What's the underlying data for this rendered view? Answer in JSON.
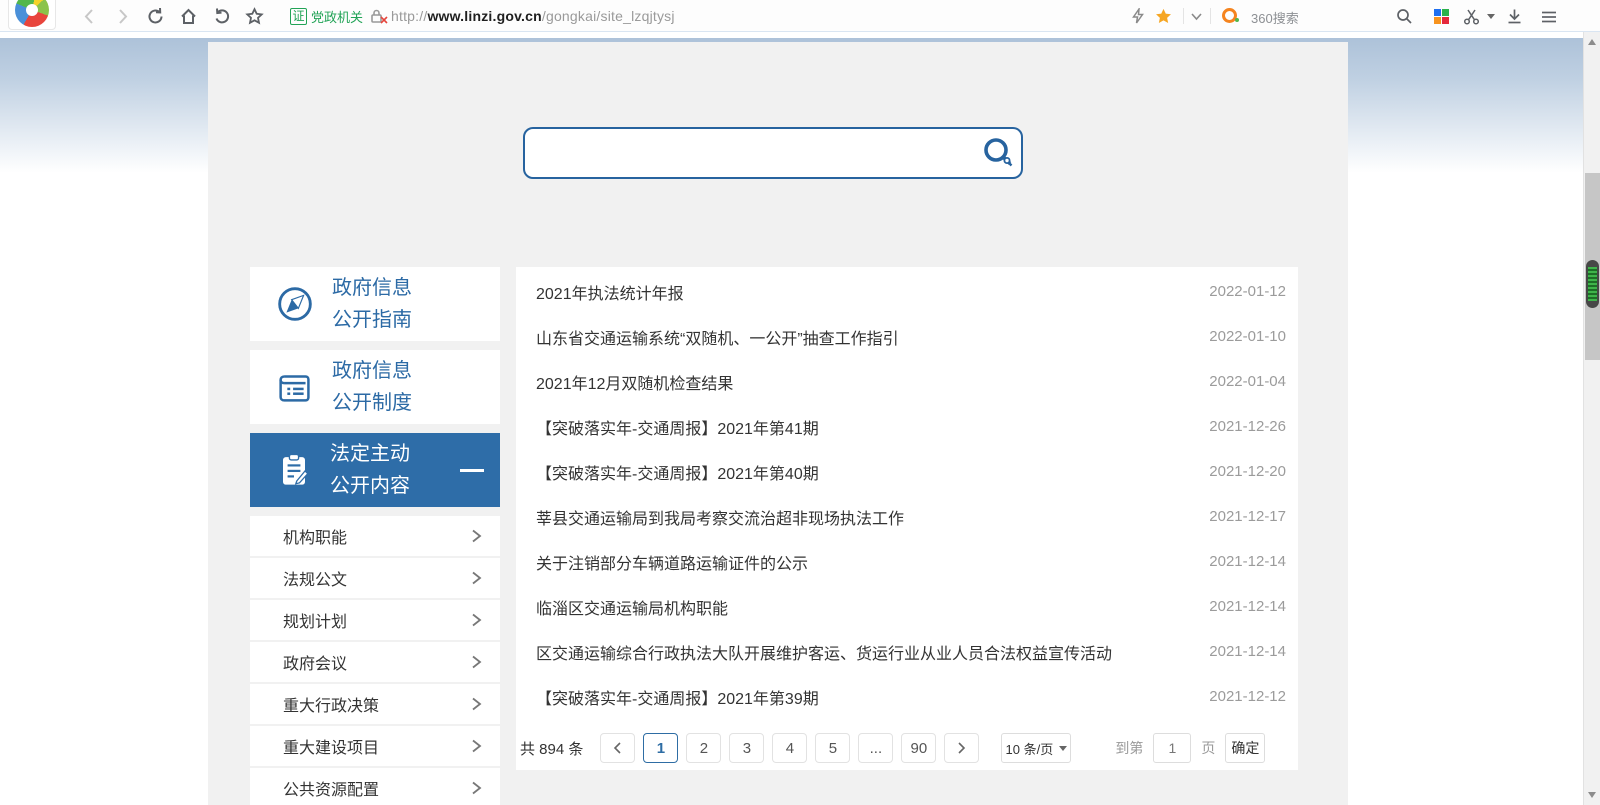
{
  "browser": {
    "cert_badge": "证",
    "cert_label": "党政机关",
    "url_prefix": "http://",
    "url_domain": "www.linzi.gov.cn",
    "url_path": "/gongkai/site_lzqjtysj",
    "search_engine_label": "360搜索"
  },
  "search": {
    "value": "",
    "placeholder": ""
  },
  "sidebar": {
    "items": [
      {
        "line1": "政府信息",
        "line2": "公开指南"
      },
      {
        "line1": "政府信息",
        "line2": "公开制度"
      },
      {
        "line1": "法定主动",
        "line2": "公开内容"
      }
    ],
    "subitems": [
      {
        "label": "机构职能"
      },
      {
        "label": "法规公文"
      },
      {
        "label": "规划计划"
      },
      {
        "label": "政府会议"
      },
      {
        "label": "重大行政决策"
      },
      {
        "label": "重大建设项目"
      },
      {
        "label": "公共资源配置"
      }
    ]
  },
  "list": {
    "items": [
      {
        "title": "2021年执法统计年报",
        "date": "2022-01-12"
      },
      {
        "title": "山东省交通运输系统“双随机、一公开”抽查工作指引",
        "date": "2022-01-10"
      },
      {
        "title": "2021年12月双随机检查结果",
        "date": "2022-01-04"
      },
      {
        "title": "【突破落实年-交通周报】2021年第41期",
        "date": "2021-12-26"
      },
      {
        "title": "【突破落实年-交通周报】2021年第40期",
        "date": "2021-12-20"
      },
      {
        "title": "莘县交通运输局到我局考察交流治超非现场执法工作",
        "date": "2021-12-17"
      },
      {
        "title": "关于注销部分车辆道路运输证件的公示",
        "date": "2021-12-14"
      },
      {
        "title": "临淄区交通运输局机构职能",
        "date": "2021-12-14"
      },
      {
        "title": "区交通运输综合行政执法大队开展维护客运、货运行业从业人员合法权益宣传活动",
        "date": "2021-12-14"
      },
      {
        "title": "【突破落实年-交通周报】2021年第39期",
        "date": "2021-12-12"
      }
    ]
  },
  "pagination": {
    "total_label": "共 894 条",
    "pages": [
      "1",
      "2",
      "3",
      "4",
      "5",
      "...",
      "90"
    ],
    "current_page": "1",
    "page_size_label": "10 条/页",
    "goto_label": "到第",
    "goto_value": "1",
    "page_unit": "页",
    "confirm_label": "确定"
  },
  "colors": {
    "accent_blue": "#2e6da8",
    "badge_green": "#21a356",
    "star_orange": "#f6a623",
    "date_gray": "#9b9b9b"
  }
}
